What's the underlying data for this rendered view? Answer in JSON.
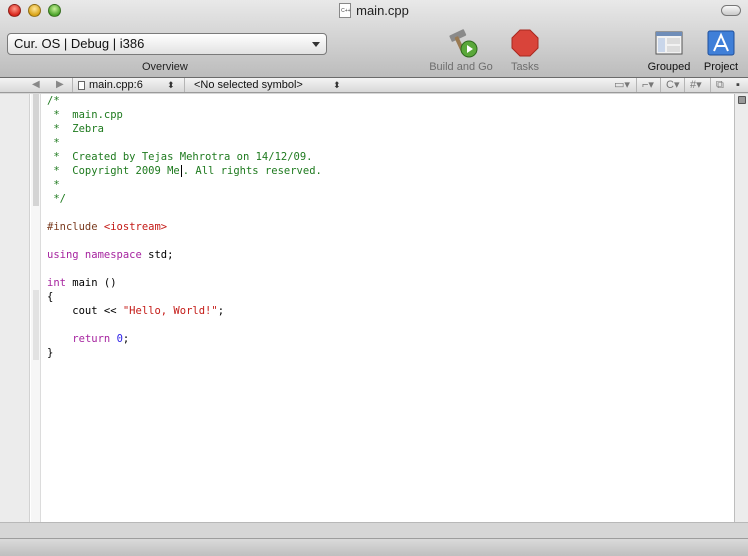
{
  "window": {
    "title": "main.cpp"
  },
  "toolbar": {
    "config_popup": "Cur. OS | Debug | i386",
    "overview_label": "Overview",
    "build_label": "Build and Go",
    "tasks_label": "Tasks",
    "grouped_label": "Grouped",
    "project_label": "Project"
  },
  "navigator": {
    "file_location": "main.cpp:6",
    "symbol": "<No selected symbol>",
    "lang_menu": "C",
    "hash_menu": "#"
  },
  "icons": {
    "build": "hammer-play-icon",
    "tasks": "stop-octagon-icon",
    "grouped": "grouped-window-icon",
    "project": "project-app-icon"
  },
  "colors": {
    "comment": "#1e7a1e",
    "preprocessor": "#7a3b1f",
    "string": "#c41a16",
    "keyword": "#a6249f",
    "number": "#2a1ee8"
  },
  "code": {
    "l1": "/*",
    "l2": " *  main.cpp",
    "l3": " *  Zebra",
    "l4": " *",
    "l5": " *  Created by Tejas Mehrotra on 14/12/09.",
    "l6a": " *  Copyright 2009 Me",
    "l6b": ". All rights reserved.",
    "l7": " *",
    "l8": " */",
    "l10a": "#include ",
    "l10b": "<iostream>",
    "l12a": "using namespace",
    "l12b": " std;",
    "l14a": "int",
    "l14b": " main ()",
    "l15": "{",
    "l16a": "    cout << ",
    "l16b": "\"Hello, World!\"",
    "l16c": ";",
    "l18a": "    ",
    "l18b": "return",
    "l18c": " ",
    "l18d": "0",
    "l18e": ";",
    "l19": "}"
  }
}
